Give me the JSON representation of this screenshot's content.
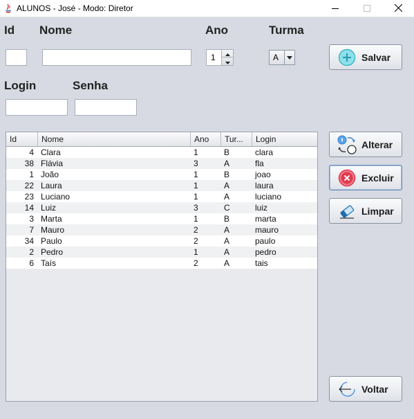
{
  "window": {
    "title": "ALUNOS - José - Modo: Diretor",
    "minimize_icon": "minimize-icon",
    "maximize_icon": "maximize-icon",
    "close_icon": "close-icon"
  },
  "form": {
    "id_label": "Id",
    "nome_label": "Nome",
    "ano_label": "Ano",
    "turma_label": "Turma",
    "login_label": "Login",
    "senha_label": "Senha",
    "id_value": "",
    "nome_value": "",
    "login_value": "",
    "senha_value": "",
    "ano_value": "1",
    "turma_value": "A"
  },
  "buttons": {
    "salvar": "Salvar",
    "alterar": "Alterar",
    "excluir": "Excluir",
    "limpar": "Limpar",
    "voltar": "Voltar"
  },
  "table": {
    "columns": [
      "Id",
      "Nome",
      "Ano",
      "Tur...",
      "Login"
    ],
    "rows": [
      [
        "4",
        "Clara",
        "1",
        "B",
        "clara"
      ],
      [
        "38",
        "Flávia",
        "3",
        "A",
        "fla"
      ],
      [
        "1",
        "João",
        "1",
        "B",
        "joao"
      ],
      [
        "22",
        "Laura",
        "1",
        "A",
        "laura"
      ],
      [
        "23",
        "Luciano",
        "1",
        "A",
        "luciano"
      ],
      [
        "14",
        "Luiz",
        "3",
        "C",
        "luiz"
      ],
      [
        "3",
        "Marta",
        "1",
        "B",
        "marta"
      ],
      [
        "7",
        "Mauro",
        "2",
        "A",
        "mauro"
      ],
      [
        "34",
        "Paulo",
        "2",
        "A",
        "paulo"
      ],
      [
        "2",
        "Pedro",
        "1",
        "A",
        "pedro"
      ],
      [
        "6",
        "Taís",
        "2",
        "A",
        "tais"
      ]
    ]
  },
  "colors": {
    "background": "#d7dae2",
    "salvar_icon": "#3fb8c8",
    "excluir_icon": "#e03a4e",
    "alterar_icon": "#3a8de0"
  }
}
